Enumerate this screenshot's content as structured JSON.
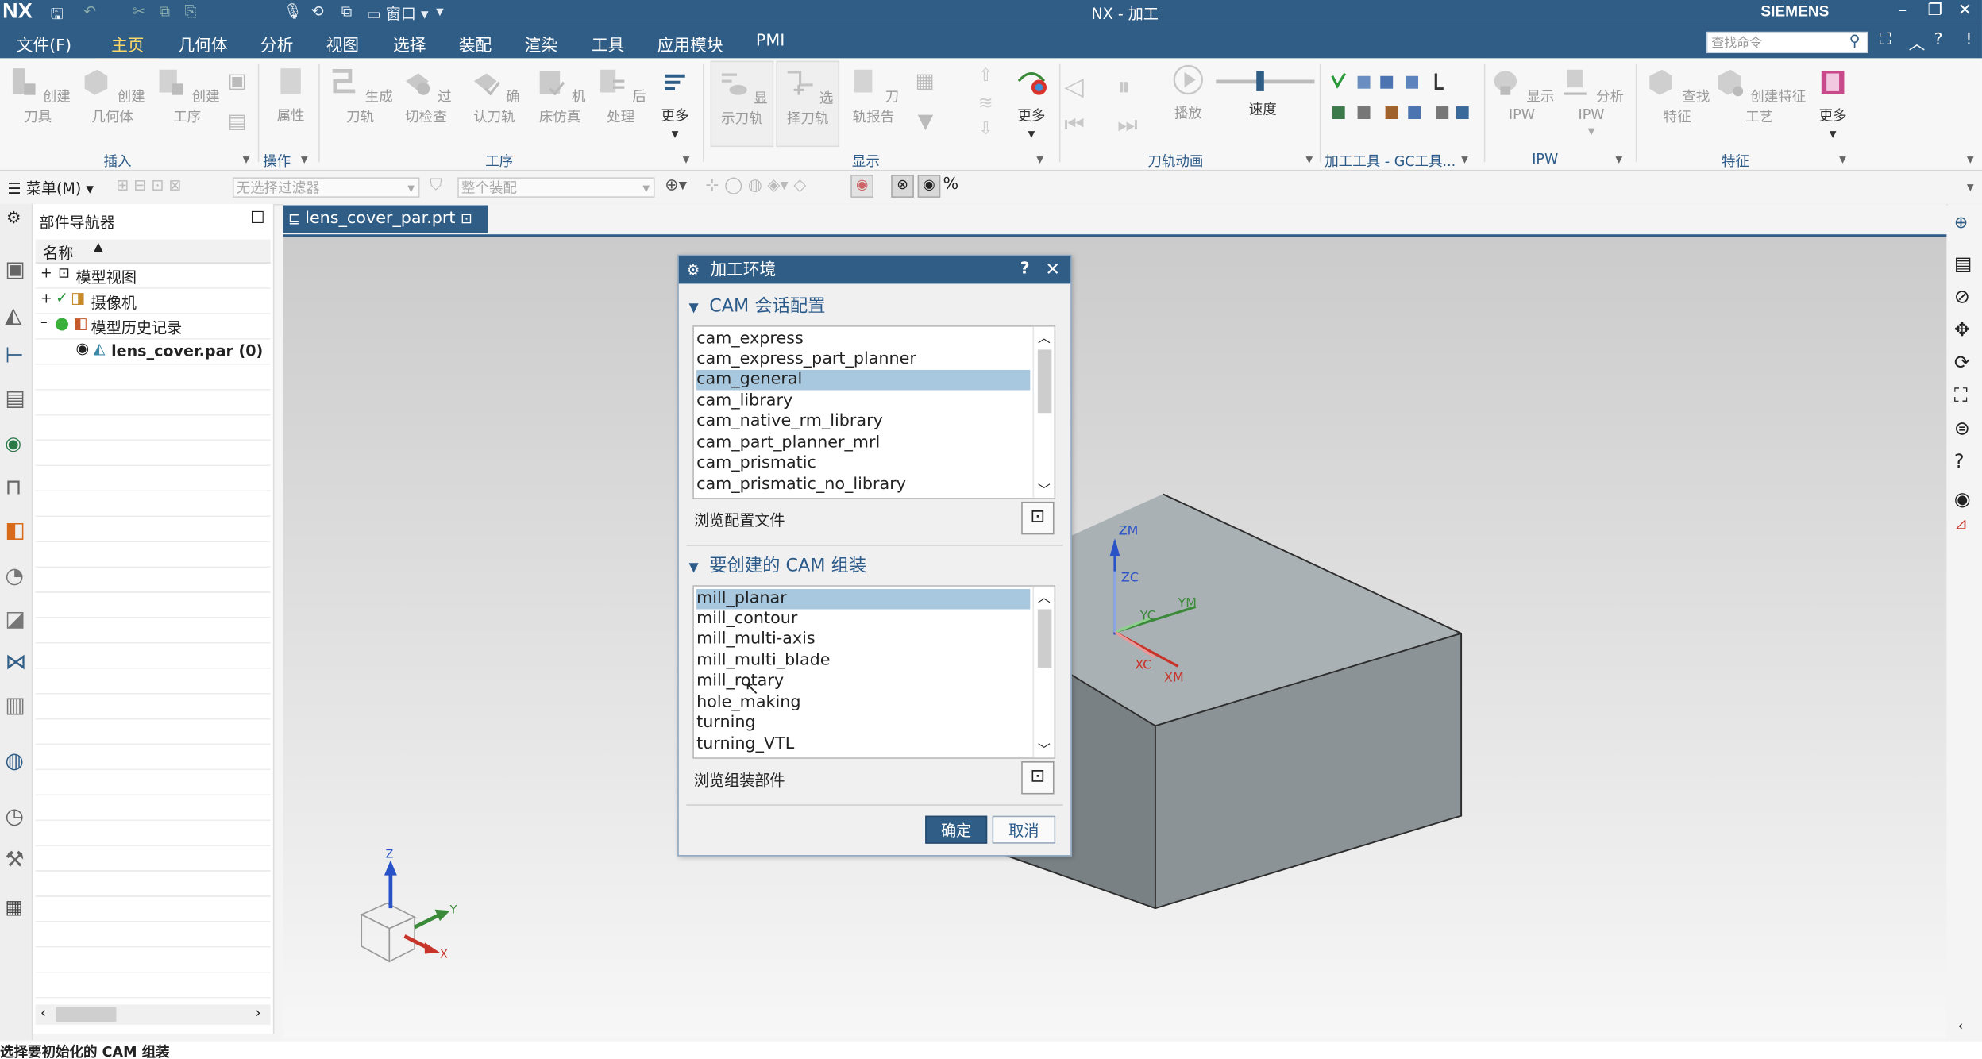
{
  "titlebar": {
    "logo": "NX",
    "title": "NX - 加工",
    "brand": "SIEMENS",
    "window_menu": "窗口",
    "min": "–",
    "restore": "❐",
    "close": "✕"
  },
  "menubar": {
    "tabs": [
      "文件(F)",
      "主页",
      "几何体",
      "分析",
      "视图",
      "选择",
      "装配",
      "渲染",
      "工具",
      "应用模块",
      "PMI"
    ],
    "search_placeholder": "查找命令"
  },
  "ribbon": {
    "buttons": {
      "create_tool": "创建刀具",
      "create_geometry": "创建几何体",
      "create_operation": "创建工序",
      "properties": "属性",
      "generate_toolpath": "生成刀轨",
      "gouge_check": "过切检查",
      "verify_toolpath": "确认刀轨",
      "machine_sim": "机床仿真",
      "postprocess": "后处理",
      "more1": "更多",
      "show_toolpath": "显示刀轨",
      "select_toolpath": "选择刀轨",
      "toolpath_report": "刀轨报告",
      "more2": "更多",
      "play": "播放",
      "speed": "速度",
      "show_ipw": "显示 IPW",
      "analyze_ipw": "分析 IPW",
      "find_feature": "查找特征",
      "create_feature_process": "创建特征工艺",
      "more3": "更多"
    },
    "groups": {
      "insert": "插入",
      "operation": "操作",
      "process": "工序",
      "display": "显示",
      "toolpath_anim": "刀轨动画",
      "machining_tools": "加工工具 - GC工具...",
      "ipw": "IPW",
      "features": "特征"
    },
    "speed_level": 0.45
  },
  "toolbar2": {
    "menu": "菜单(M)",
    "filter": "无选择过滤器",
    "assembly": "整个装配"
  },
  "navigator": {
    "title": "部件导航器",
    "column": "名称",
    "items": [
      {
        "label": "模型视图"
      },
      {
        "label": "摄像机"
      },
      {
        "label": "模型历史记录"
      },
      {
        "label": "lens_cover.par (0)"
      }
    ]
  },
  "doc_tab": {
    "filename": "lens_cover_par.prt"
  },
  "dialog": {
    "title": "加工环境",
    "help": "?",
    "close": "✕",
    "section1": "CAM 会话配置",
    "configs": [
      "cam_express",
      "cam_express_part_planner",
      "cam_general",
      "cam_library",
      "cam_native_rm_library",
      "cam_part_planner_mrl",
      "cam_prismatic",
      "cam_prismatic_no_library"
    ],
    "selected_config": "cam_general",
    "browse_config": "浏览配置文件",
    "section2": "要创建的 CAM 组装",
    "setups": [
      "mill_planar",
      "mill_contour",
      "mill_multi-axis",
      "mill_multi_blade",
      "mill_rotary",
      "hole_making",
      "turning",
      "turning_VTL"
    ],
    "selected_setup": "mill_planar",
    "browse_assembly": "浏览组装部件",
    "ok": "确定",
    "cancel": "取消"
  },
  "viewport": {
    "wcs_labels": {
      "zm": "ZM",
      "zc": "ZC",
      "ym": "YM",
      "yc": "YC",
      "xc": "XC",
      "xm": "XM"
    },
    "triad_labels": {
      "z": "Z",
      "y": "Y",
      "x": "X"
    }
  },
  "status": {
    "text": "选择要初始化的 CAM 组装"
  },
  "colors": {
    "accent": "#2f5d86",
    "tab_highlight": "#f2b13a",
    "selection": "#a8c8e0",
    "ok_button": "#2f5d86"
  }
}
